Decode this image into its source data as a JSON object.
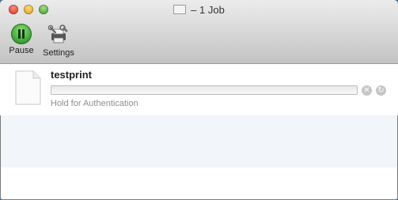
{
  "window": {
    "title": "– 1 Job"
  },
  "toolbar": {
    "pause_label": "Pause",
    "settings_label": "Settings"
  },
  "jobs": [
    {
      "name": "testprint",
      "status": "Hold for Authentication",
      "progress": 0
    }
  ],
  "icons": {
    "pause": "pause-icon",
    "settings": "settings-icon",
    "document": "document-icon",
    "delete": "x-circle-icon",
    "resume": "refresh-icon"
  },
  "colors": {
    "pause_green": "#2f9a2a",
    "status_gray": "#8e8e8e",
    "alt_row": "#f2f5f9"
  }
}
